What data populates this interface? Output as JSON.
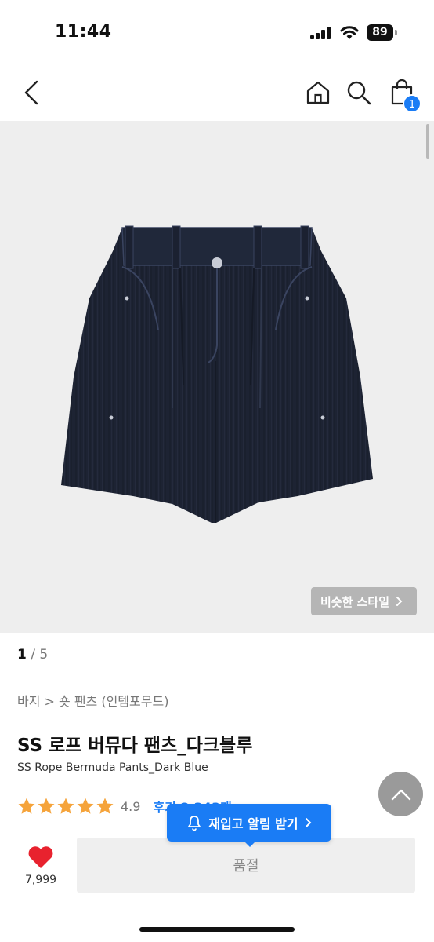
{
  "status_bar": {
    "time": "11:44",
    "battery": "89"
  },
  "nav": {
    "cart_count": "1"
  },
  "gallery": {
    "similar_style_label": "비슷한 스타일"
  },
  "pager": {
    "current": "1",
    "separator": " / ",
    "total": "5"
  },
  "product": {
    "breadcrumb": "바지 > 숏 팬츠 (인템포무드)",
    "title_ko": "SS 로프 버뮤다 팬츠_다크블루",
    "title_en": "SS Rope Bermuda Pants_Dark Blue",
    "rating": "4.9",
    "rating_stars": 5,
    "review_label": "후기 2,243개"
  },
  "bottom_bar": {
    "like_count": "7,999",
    "soldout_label": "품절",
    "restock_label": "재입고 알림 받기"
  },
  "colors": {
    "accent": "#1a7cf5",
    "star": "#f5a33a",
    "heart": "#e8222e"
  }
}
